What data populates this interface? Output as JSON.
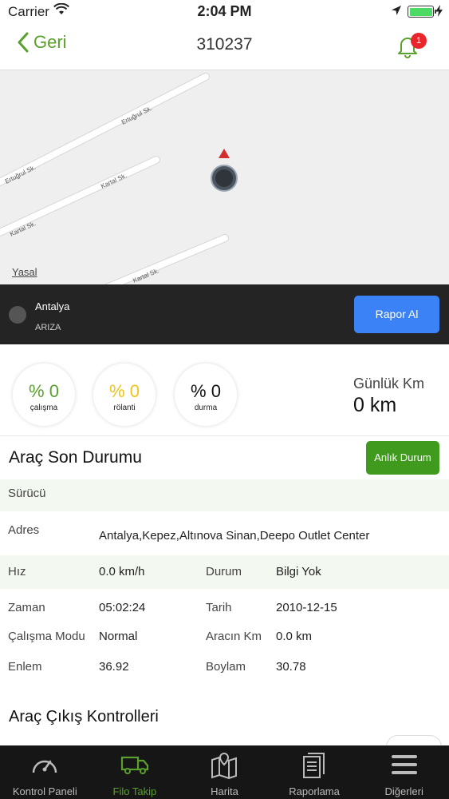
{
  "status_bar": {
    "carrier": "Carrier",
    "time": "2:04 PM"
  },
  "nav": {
    "back_label": "Geri",
    "title": "310237",
    "notification_count": "1"
  },
  "map": {
    "streets": [
      "Ertuğrul Sk.",
      "Ertuğrul Sk.",
      "Kartal Sk.",
      "Kartal Sk.",
      "Kartal Sk."
    ],
    "legal_label": "Yasal"
  },
  "vehicle_info": {
    "city": "Antalya",
    "status": "ARIZA",
    "report_button": "Rapor Al"
  },
  "stats": {
    "items": [
      {
        "value": "% 0",
        "label": "çalışma",
        "color": "#5aa02c"
      },
      {
        "value": "% 0",
        "label": "rölanti",
        "color": "#f0c419"
      },
      {
        "value": "% 0",
        "label": "durma",
        "color": "#111111"
      }
    ],
    "daily_km_label": "Günlük Km",
    "daily_km_value": "0 km"
  },
  "last_status": {
    "title": "Araç Son Durumu",
    "instant_button": "Anlık Durum",
    "driver_label": "Sürücü",
    "address_label": "Adres",
    "address_value": "Antalya,Kepez,Altınova Sinan,Deepo Outlet Center",
    "speed_label": "Hız",
    "speed_value": "0.0 km/h",
    "state_label": "Durum",
    "state_value": "Bilgi Yok",
    "time_label": "Zaman",
    "time_value": "05:02:24",
    "date_label": "Tarih",
    "date_value": "2010-12-15",
    "mode_label": "Çalışma Modu",
    "mode_value": "Normal",
    "km_label": "Aracın Km",
    "km_value": "0.0 km",
    "lat_label": "Enlem",
    "lat_value": "36.92",
    "lon_label": "Boylam",
    "lon_value": "30.78"
  },
  "exit_controls": {
    "title": "Araç Çıkış Kontrolleri"
  },
  "tabs": [
    {
      "label": "Kontrol Paneli",
      "icon": "gauge-icon"
    },
    {
      "label": "Filo Takip",
      "icon": "truck-icon"
    },
    {
      "label": "Harita",
      "icon": "map-icon"
    },
    {
      "label": "Raporlama",
      "icon": "document-icon"
    },
    {
      "label": "Diğerleri",
      "icon": "menu-icon"
    }
  ],
  "colors": {
    "accent_green": "#5aa02c",
    "button_green": "#3f9a1e",
    "button_blue": "#3b82f6",
    "badge_red": "#e8262c",
    "dark_bar": "#242424"
  }
}
